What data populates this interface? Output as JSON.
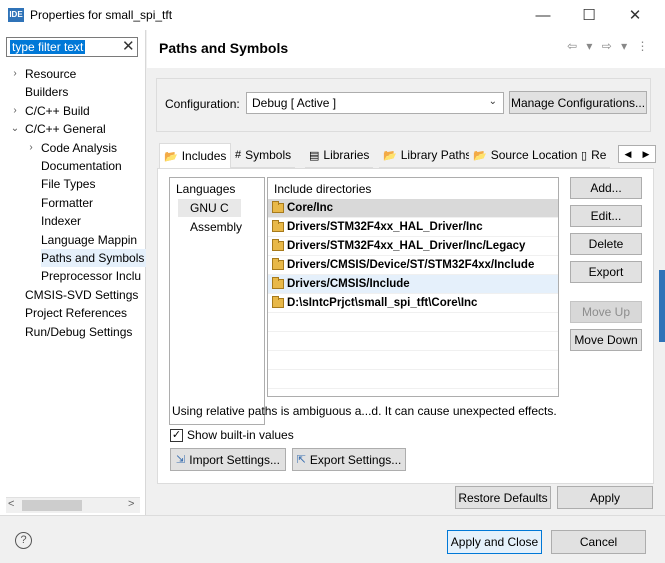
{
  "window": {
    "app_icon": "IDE",
    "title": "Properties for small_spi_tft",
    "minimize": "—",
    "maximize": "☐",
    "close": "✕"
  },
  "filter": {
    "text": "type filter text",
    "clear": "✕"
  },
  "tree": [
    {
      "label": "Resource",
      "arrow": "›",
      "level": 0
    },
    {
      "label": "Builders",
      "arrow": "",
      "level": 0
    },
    {
      "label": "C/C++ Build",
      "arrow": "›",
      "level": 0
    },
    {
      "label": "C/C++ General",
      "arrow": "⌄",
      "level": 0
    },
    {
      "label": "Code Analysis",
      "arrow": "›",
      "level": 1
    },
    {
      "label": "Documentation",
      "arrow": "",
      "level": 1
    },
    {
      "label": "File Types",
      "arrow": "",
      "level": 1
    },
    {
      "label": "Formatter",
      "arrow": "",
      "level": 1
    },
    {
      "label": "Indexer",
      "arrow": "",
      "level": 1
    },
    {
      "label": "Language Mappin",
      "arrow": "",
      "level": 1
    },
    {
      "label": "Paths and Symbols",
      "arrow": "",
      "level": 1,
      "selected": true
    },
    {
      "label": "Preprocessor Inclu",
      "arrow": "",
      "level": 1
    },
    {
      "label": "CMSIS-SVD Settings",
      "arrow": "",
      "level": 0
    },
    {
      "label": "Project References",
      "arrow": "",
      "level": 0
    },
    {
      "label": "Run/Debug Settings",
      "arrow": "",
      "level": 0
    }
  ],
  "page": {
    "title": "Paths and Symbols",
    "nav_icons": "⇦ ▾ ⇨ ▾ ⋮"
  },
  "config": {
    "label": "Configuration:",
    "value": "Debug  [ Active ]",
    "chevron": "⌄",
    "manage_label": "Manage Configurations..."
  },
  "tabs": [
    {
      "label": "Includes",
      "icon": "📂",
      "active": true
    },
    {
      "label": "Symbols",
      "icon": "#",
      "active": false
    },
    {
      "label": "Libraries",
      "icon": "▤",
      "active": false
    },
    {
      "label": "Library Paths",
      "icon": "📂",
      "active": false
    },
    {
      "label": "Source Location",
      "icon": "📂",
      "active": false
    },
    {
      "label": "Re",
      "icon": "▯",
      "active": false
    }
  ],
  "tab_scroll": {
    "left": "◀",
    "right": "▶"
  },
  "languages": {
    "header": "Languages",
    "items": [
      {
        "label": "GNU C",
        "selected": true
      },
      {
        "label": "Assembly",
        "selected": false
      }
    ]
  },
  "includes": {
    "header": "Include directories",
    "items": [
      {
        "path": "Core/Inc",
        "state": "selected"
      },
      {
        "path": "Drivers/STM32F4xx_HAL_Driver/Inc",
        "state": ""
      },
      {
        "path": "Drivers/STM32F4xx_HAL_Driver/Inc/Legacy",
        "state": ""
      },
      {
        "path": "Drivers/CMSIS/Device/ST/STM32F4xx/Include",
        "state": ""
      },
      {
        "path": "Drivers/CMSIS/Include",
        "state": "hover"
      },
      {
        "path": "D:\\sIntcPrjct\\small_spi_tft\\Core\\Inc",
        "state": ""
      }
    ]
  },
  "side_buttons": {
    "add": "Add...",
    "edit": "Edit...",
    "delete": "Delete",
    "export": "Export",
    "move_up": "Move Up",
    "move_down": "Move Down"
  },
  "warning": "Using relative paths is ambiguous a...d. It can cause unexpected effects.",
  "show_builtin": {
    "label": "Show built-in values",
    "checked": "✓"
  },
  "import_settings": "Import Settings...",
  "export_settings": "Export Settings...",
  "restore_defaults": "Restore Defaults",
  "apply": "Apply",
  "apply_and_close": "Apply and Close",
  "cancel": "Cancel",
  "help": "?"
}
